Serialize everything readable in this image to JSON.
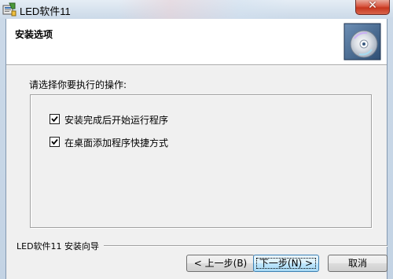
{
  "window": {
    "title": "LED软件11",
    "close_glyph": "✕",
    "app_icon": "installer-app-icon"
  },
  "header": {
    "title": "安装选项",
    "logo_icon": "cd-disc-icon"
  },
  "content": {
    "instruction": "请选择你要执行的操作:",
    "options": [
      {
        "label": "安装完成后开始运行程序",
        "checked": true
      },
      {
        "label": "在桌面添加程序快捷方式",
        "checked": true
      }
    ]
  },
  "footer": {
    "brand": "LED软件11 安装向导"
  },
  "buttons": {
    "back": "< 上一步(B)",
    "next": "下一步(N) >",
    "cancel": "取消"
  },
  "colors": {
    "dialog_bg": "#f0f0f0",
    "header_bg": "#ffffff",
    "close_button": "#c7371f",
    "default_button_border": "#3c7fb1"
  }
}
